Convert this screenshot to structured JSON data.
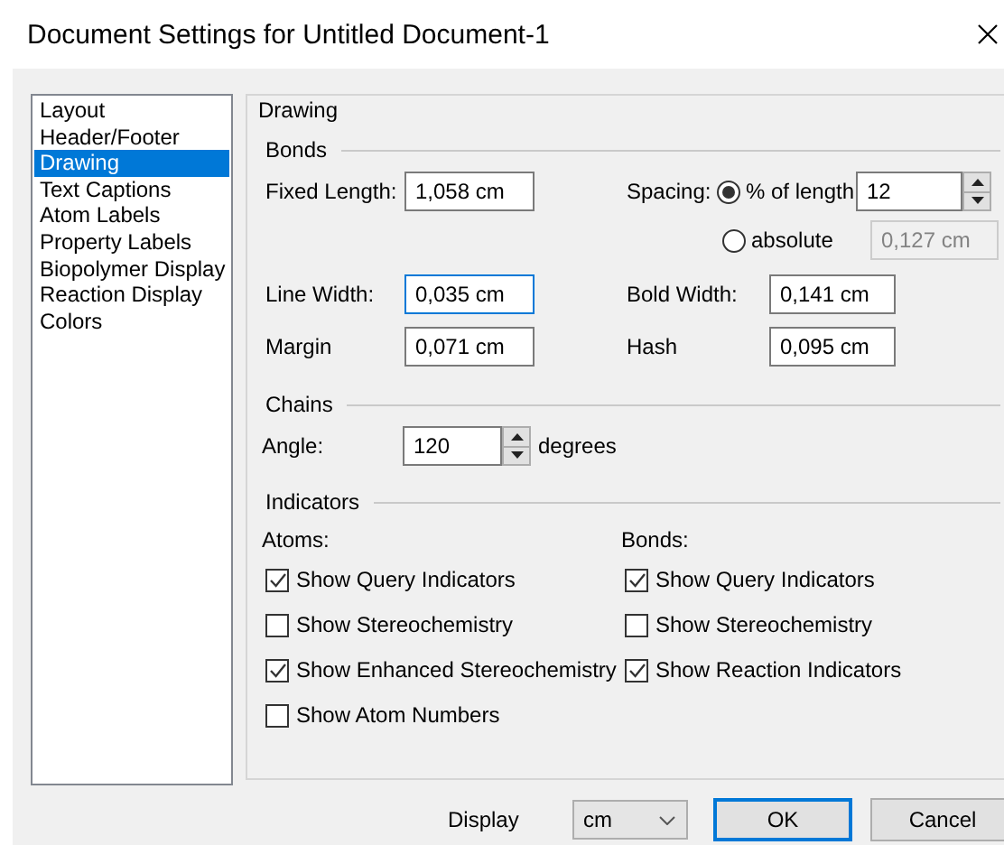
{
  "window": {
    "title": "Document Settings for Untitled Document-1"
  },
  "sidebar": {
    "items": [
      {
        "label": "Layout",
        "selected": false
      },
      {
        "label": "Header/Footer",
        "selected": false
      },
      {
        "label": "Drawing",
        "selected": true
      },
      {
        "label": "Text Captions",
        "selected": false
      },
      {
        "label": "Atom Labels",
        "selected": false
      },
      {
        "label": "Property Labels",
        "selected": false
      },
      {
        "label": "Biopolymer Display",
        "selected": false
      },
      {
        "label": "Reaction Display",
        "selected": false
      },
      {
        "label": "Colors",
        "selected": false
      }
    ]
  },
  "panel": {
    "title": "Drawing",
    "bonds": {
      "heading": "Bonds",
      "fixed_length": {
        "label": "Fixed Length:",
        "value": "1,058 cm",
        "focused": false
      },
      "spacing": {
        "label": "Spacing:",
        "options": [
          {
            "label": "% of length",
            "value": "12",
            "selected": true
          },
          {
            "label": "absolute",
            "value": "0,127 cm",
            "selected": false
          }
        ]
      },
      "line_width": {
        "label": "Line Width:",
        "value": "0,035 cm",
        "focused": true
      },
      "bold_width": {
        "label": "Bold Width:",
        "value": "0,141 cm",
        "focused": false
      },
      "margin": {
        "label": "Margin",
        "value": "0,071 cm",
        "focused": false
      },
      "hash": {
        "label": "Hash",
        "value": "0,095 cm",
        "focused": false
      }
    },
    "chains": {
      "heading": "Chains",
      "angle": {
        "label": "Angle:",
        "value": "120",
        "unit": "degrees"
      }
    },
    "indicators": {
      "heading": "Indicators",
      "columns": [
        {
          "heading": "Atoms:",
          "items": [
            {
              "label": "Show Query Indicators",
              "checked": true
            },
            {
              "label": "Show Stereochemistry",
              "checked": false
            },
            {
              "label": "Show Enhanced Stereochemistry",
              "checked": true
            },
            {
              "label": "Show Atom Numbers",
              "checked": false
            }
          ]
        },
        {
          "heading": "Bonds:",
          "items": [
            {
              "label": "Show Query Indicators",
              "checked": true
            },
            {
              "label": "Show Stereochemistry",
              "checked": false
            },
            {
              "label": "Show Reaction Indicators",
              "checked": true
            }
          ]
        }
      ]
    }
  },
  "footer": {
    "display_label": "Display",
    "units": "cm",
    "buttons": [
      {
        "label": "OK",
        "default": true
      },
      {
        "label": "Cancel",
        "default": false
      }
    ]
  }
}
